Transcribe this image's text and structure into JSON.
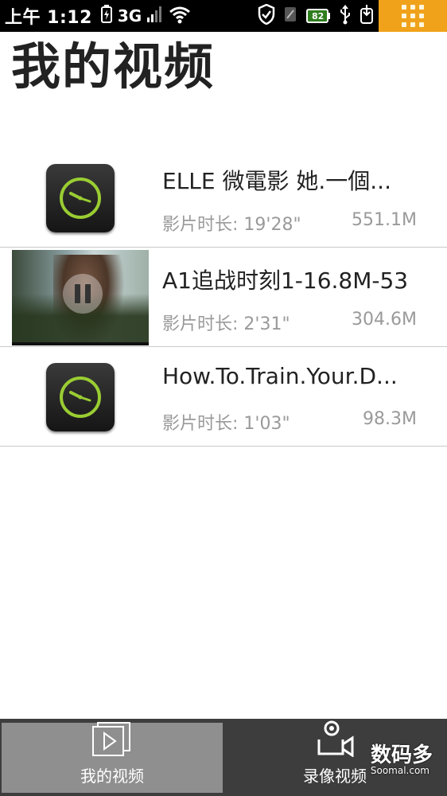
{
  "status_bar": {
    "time": "上午 1:12",
    "network": "3G",
    "battery_badge": "82"
  },
  "page": {
    "title": "我的视频"
  },
  "videos": [
    {
      "name": "ELLE 微電影 她.一個...",
      "duration": "影片时长: 19'28\"",
      "size": "551.1M",
      "thumbnail": "clock-icon"
    },
    {
      "name": "A1追战时刻1-16.8M-53",
      "duration": "影片时长: 2'31\"",
      "size": "304.6M",
      "thumbnail": "video-frame"
    },
    {
      "name": "How.To.Train.Your.D...",
      "duration": "影片时长: 1'03\"",
      "size": "98.3M",
      "thumbnail": "clock-icon"
    }
  ],
  "tabs": [
    {
      "label": "我的视频",
      "icon": "video-library-icon",
      "selected": true
    },
    {
      "label": "录像视频",
      "icon": "video-camera-icon",
      "selected": false
    }
  ],
  "watermark": {
    "text": "数码多",
    "sub": "Soomal.com"
  },
  "colors": {
    "accent": "#f0a21a",
    "clock_green": "#9acd32",
    "tab_bg": "#3d3d3d",
    "tab_selected_bg": "#8f8f8f"
  }
}
